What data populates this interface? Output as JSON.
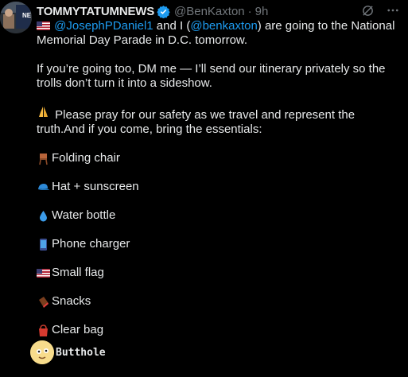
{
  "post": {
    "display_name": "TOMMYTATUMNEWS",
    "handle": "@BenKaxton",
    "separator": "·",
    "time": "9h",
    "avatar_text": "NE",
    "line1_mention1": "@JosephPDaniel1",
    "line1_mid": " and I (",
    "line1_mention2": "@benkaxton",
    "line1_end": ") are going to the National Memorial Day Parade in D.C. tomorrow.",
    "para2": "If you’re going too, DM me — I’ll send our itinerary privately so the trolls don’t turn it into a sideshow.",
    "para3": "Please pray for our safety as we travel and represent the truth.And if you come, bring the essentials:",
    "items": [
      {
        "icon": "folding-chair-icon",
        "label": "Folding chair"
      },
      {
        "icon": "cap-icon",
        "label": "Hat + sunscreen"
      },
      {
        "icon": "water-drop-icon",
        "label": "Water bottle"
      },
      {
        "icon": "phone-icon",
        "label": "Phone charger"
      },
      {
        "icon": "us-flag-icon",
        "label": "Small flag"
      },
      {
        "icon": "chocolate-bar-icon",
        "label": "Snacks"
      },
      {
        "icon": "bag-icon",
        "label": "Clear bag"
      }
    ]
  },
  "bottom_user": {
    "name": "Butthole"
  },
  "colors": {
    "background": "#000000",
    "text": "#e7e9ea",
    "muted": "#71767b",
    "link": "#1d9bf0",
    "verified": "#1d9bf0"
  }
}
